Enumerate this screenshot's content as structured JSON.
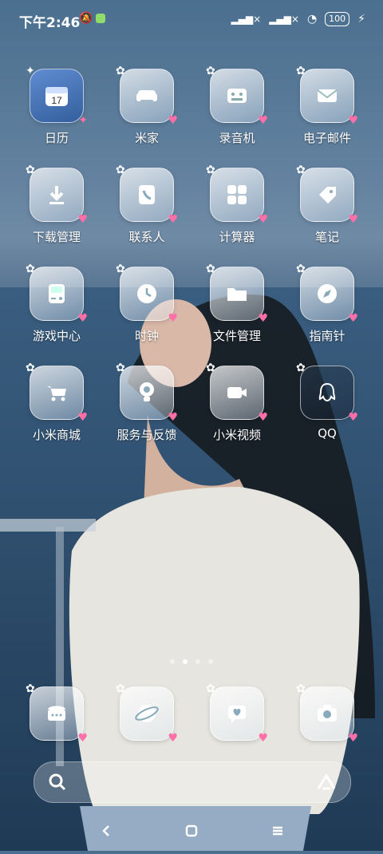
{
  "status": {
    "time": "下午2:46",
    "battery": "100"
  },
  "apps": [
    {
      "label": "日历",
      "icon": "calendar-icon",
      "badge": "17"
    },
    {
      "label": "米家",
      "icon": "sofa-icon"
    },
    {
      "label": "录音机",
      "icon": "recorder-icon"
    },
    {
      "label": "电子邮件",
      "icon": "mail-icon"
    },
    {
      "label": "下载管理",
      "icon": "download-icon"
    },
    {
      "label": "联系人",
      "icon": "contacts-icon"
    },
    {
      "label": "计算器",
      "icon": "calculator-icon"
    },
    {
      "label": "笔记",
      "icon": "tag-icon"
    },
    {
      "label": "游戏中心",
      "icon": "gameboy-icon"
    },
    {
      "label": "时钟",
      "icon": "clock-icon"
    },
    {
      "label": "文件管理",
      "icon": "folder-icon"
    },
    {
      "label": "指南针",
      "icon": "compass-icon"
    },
    {
      "label": "小米商城",
      "icon": "cart-icon"
    },
    {
      "label": "服务与反馈",
      "icon": "bulb-icon"
    },
    {
      "label": "小米视频",
      "icon": "video-icon"
    },
    {
      "label": "QQ",
      "icon": "qq-icon"
    }
  ],
  "dock": [
    {
      "icon": "phone-icon"
    },
    {
      "icon": "browser-icon"
    },
    {
      "icon": "chat-icon"
    },
    {
      "icon": "camera-icon"
    }
  ],
  "page_indicator": {
    "count": 4,
    "active": 1
  }
}
